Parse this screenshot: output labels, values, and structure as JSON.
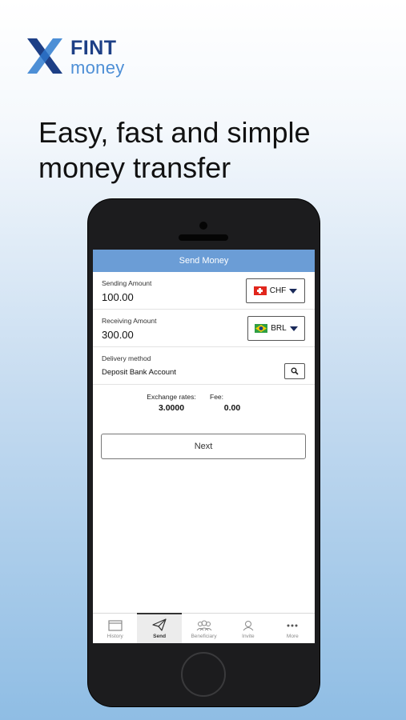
{
  "logo": {
    "fint": "FINT",
    "money": "money"
  },
  "headline": {
    "line1": "Easy, fast and simple",
    "line2": "money transfer"
  },
  "screen": {
    "title": "Send Money",
    "sending": {
      "label": "Sending Amount",
      "value": "100.00",
      "currency": "CHF"
    },
    "receiving": {
      "label": "Receiving Amount",
      "value": "300.00",
      "currency": "BRL"
    },
    "delivery": {
      "label": "Delivery method",
      "value": "Deposit Bank Account"
    },
    "rates": {
      "exchange_label": "Exchange rates:",
      "exchange_value": "3.0000",
      "fee_label": "Fee:",
      "fee_value": "0.00"
    },
    "next_label": "Next"
  },
  "tabs": [
    {
      "label": "History",
      "icon": "history-icon",
      "active": false
    },
    {
      "label": "Send",
      "icon": "send-icon",
      "active": true
    },
    {
      "label": "Beneficiary",
      "icon": "beneficiary-icon",
      "active": false
    },
    {
      "label": "Invite",
      "icon": "invite-icon",
      "active": false
    },
    {
      "label": "More",
      "icon": "more-icon",
      "active": false
    }
  ],
  "colors": {
    "brand_dark": "#1d3f86",
    "brand_light": "#4d8fd6",
    "nav_bar": "#6b9dd6"
  }
}
